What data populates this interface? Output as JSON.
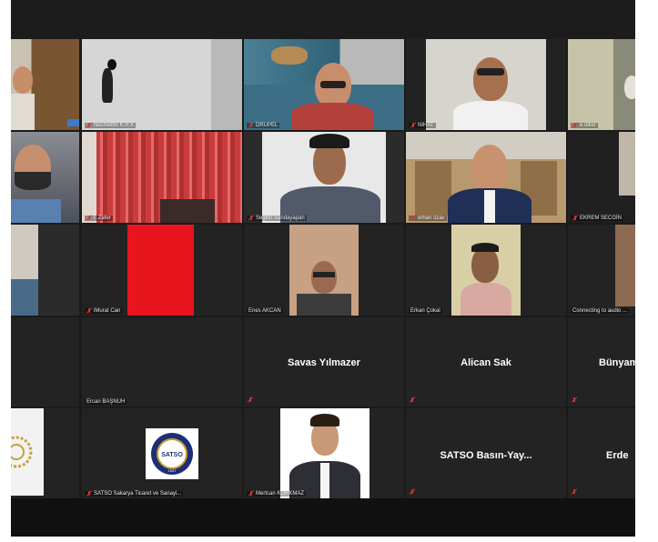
{
  "participants": {
    "r1": [
      {
        "name": ""
      },
      {
        "name": "Necmettin K.R.K"
      },
      {
        "name": "DRUPEL"
      },
      {
        "name": "NIHAT"
      },
      {
        "name": "e.ülker"
      }
    ],
    "r2": [
      {
        "name": ""
      },
      {
        "name": "i. Zafer"
      },
      {
        "name": "Seğkin Sandayapan"
      },
      {
        "name": "erhan özav"
      },
      {
        "name": "EKREM SECGİN"
      }
    ],
    "r3": [
      {
        "name": ""
      },
      {
        "name": "iMurat Can"
      },
      {
        "name": "Enes AKCAN"
      },
      {
        "name": "Erkan Çokal"
      },
      {
        "name": "Connecting to audio ..."
      }
    ],
    "r4": [
      {
        "name": ""
      },
      {
        "name": "Ercan BAŞNUH"
      },
      {
        "name": "",
        "display": "Savas Yılmazer"
      },
      {
        "name": "",
        "display": "Alican Sak"
      },
      {
        "name": "",
        "display": "Bünyamin"
      }
    ],
    "r5": [
      {
        "name": ""
      },
      {
        "name": "SATSO Sakarya Ticaret ve Sanayi..."
      },
      {
        "name": "Mertcan KORKMAZ"
      },
      {
        "name": "",
        "display": "SATSO  Basın-Yay..."
      },
      {
        "name": "",
        "display": "Erde"
      }
    ]
  },
  "logo": {
    "text": "SATSO",
    "year": "1947"
  },
  "colors": {
    "tile_bg": "#232323",
    "screen_bg": "#1a1a1a",
    "mic_muted": "#dd3333",
    "red_video": "#e8141e"
  }
}
